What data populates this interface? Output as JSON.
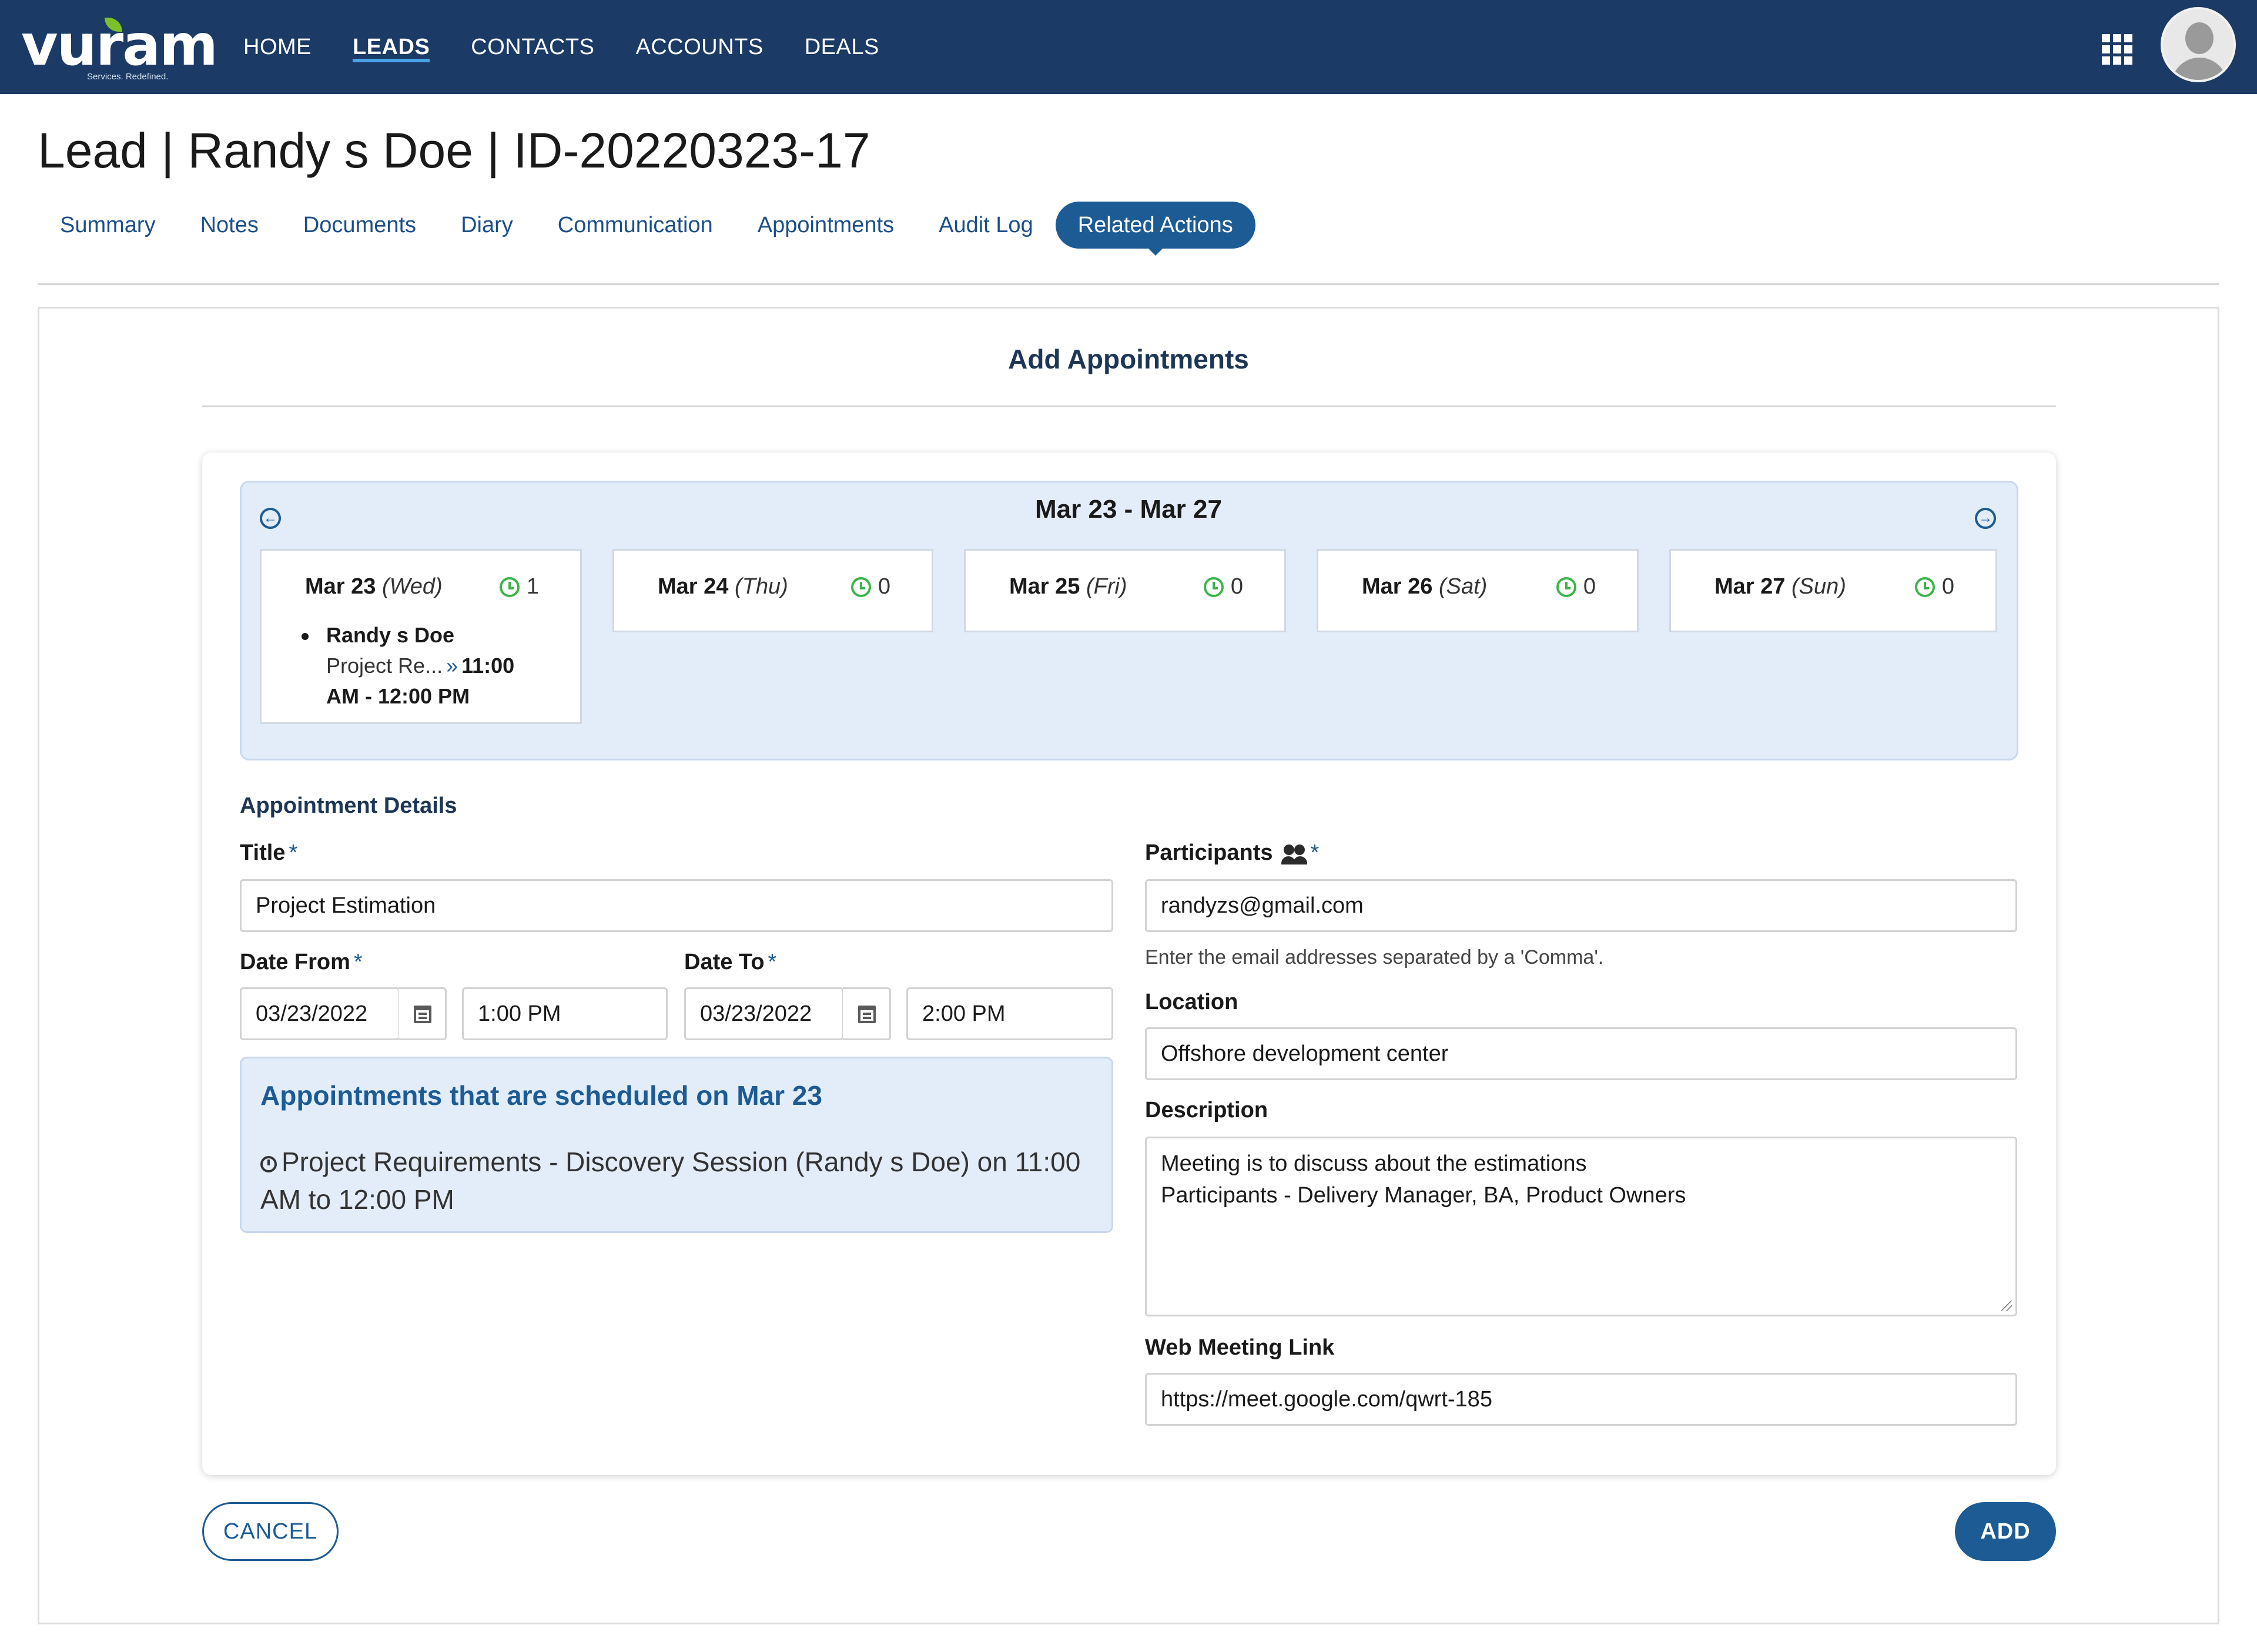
{
  "app": {
    "logo_text": "vuram",
    "logo_tagline": "Services. Redefined.",
    "nav": [
      {
        "label": "HOME",
        "active": false
      },
      {
        "label": "LEADS",
        "active": true
      },
      {
        "label": "CONTACTS",
        "active": false
      },
      {
        "label": "ACCOUNTS",
        "active": false
      },
      {
        "label": "DEALS",
        "active": false
      }
    ],
    "apps_icon": "grid-apps-icon",
    "avatar_icon": "user-avatar-icon"
  },
  "page": {
    "title": "Lead | Randy s Doe | ID-20220323-17",
    "tabs": [
      {
        "label": "Summary",
        "active": false
      },
      {
        "label": "Notes",
        "active": false
      },
      {
        "label": "Documents",
        "active": false
      },
      {
        "label": "Diary",
        "active": false
      },
      {
        "label": "Communication",
        "active": false
      },
      {
        "label": "Appointments",
        "active": false
      },
      {
        "label": "Audit Log",
        "active": false
      },
      {
        "label": "Related Actions",
        "active": true
      }
    ]
  },
  "section": {
    "title": "Add Appointments"
  },
  "calendar": {
    "range": "Mar 23 - Mar 27",
    "prev_icon": "arrow-left-circle-icon",
    "next_icon": "arrow-right-circle-icon",
    "days": [
      {
        "date": "Mar 23",
        "dow": "(Wed)",
        "count": "1",
        "appointments": [
          {
            "name": "Randy s Doe",
            "title": "Project Re...",
            "time_start": "11:00",
            "time_end": "AM  - 12:00 PM"
          }
        ]
      },
      {
        "date": "Mar 24",
        "dow": "(Thu)",
        "count": "0"
      },
      {
        "date": "Mar 25",
        "dow": "(Fri)",
        "count": "0"
      },
      {
        "date": "Mar 26",
        "dow": "(Sat)",
        "count": "0"
      },
      {
        "date": "Mar 27",
        "dow": "(Sun)",
        "count": "0"
      }
    ]
  },
  "form": {
    "section_label": "Appointment Details",
    "required_marker": "*",
    "title": {
      "label": "Title",
      "value": "Project Estimation"
    },
    "date_from": {
      "label": "Date From",
      "date": "03/23/2022",
      "time": "1:00 PM"
    },
    "date_to": {
      "label": "Date To",
      "date": "03/23/2022",
      "time": "2:00 PM"
    },
    "participants": {
      "label": "Participants",
      "value": "randyzs@gmail.com",
      "hint": "Enter the email addresses separated by a 'Comma'."
    },
    "location": {
      "label": "Location",
      "value": "Offshore development center"
    },
    "description": {
      "label": "Description",
      "line1": "Meeting is to discuss about the estimations",
      "line2": "Participants - Delivery Manager, BA, Product Owners"
    },
    "web_link": {
      "label": "Web Meeting Link",
      "value": "https://meet.google.com/qwrt-185"
    }
  },
  "scheduled": {
    "title": "Appointments that are scheduled on Mar 23",
    "item": "Project Requirements - Discovery Session (Randy s Doe) on 11:00 AM  to 12:00 PM"
  },
  "actions": {
    "cancel": "CANCEL",
    "add": "ADD"
  },
  "colors": {
    "nav_bg": "#1b3a66",
    "accent": "#1d5b94",
    "calendar_bg": "#e3edfa",
    "count_green": "#3bb54a"
  }
}
